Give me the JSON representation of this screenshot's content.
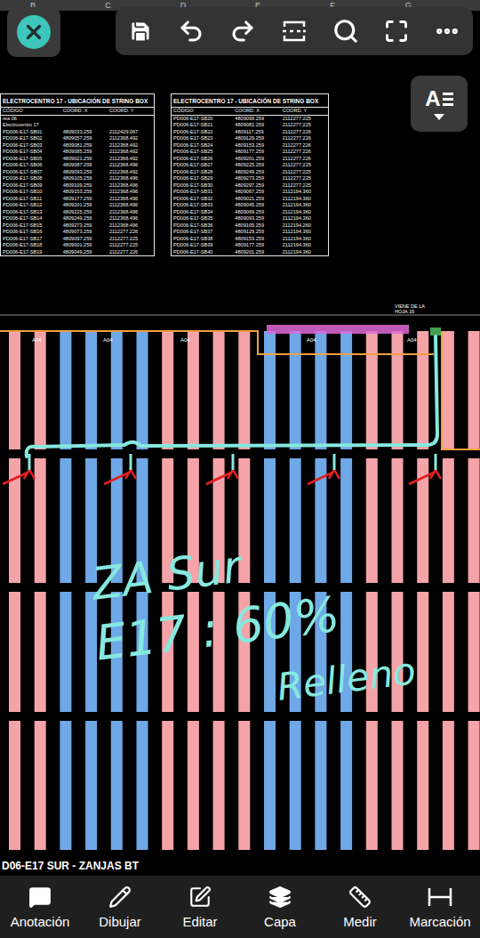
{
  "column_letters": [
    "B",
    "C",
    "D",
    "E",
    "F",
    "G"
  ],
  "format_button": {
    "label": "A"
  },
  "tables": [
    {
      "title": "ELECTROCENTRO 17 - UBICACIÓN DE STRING BOX",
      "columns": [
        "CÓDIGO",
        "COORD. X",
        "COORD. Y"
      ],
      "rows": [
        [
          "rea 06",
          "",
          ""
        ],
        [
          "Electrocentro 17",
          "",
          ""
        ],
        [
          "PD006-E17-SB01",
          "4809033.259",
          "2112429.067"
        ],
        [
          "PD006-E17-SB02",
          "4809057.259",
          "2112368.492"
        ],
        [
          "PD006-E17-SB03",
          "4809081.259",
          "2112368.492"
        ],
        [
          "PD006-E17-SB04",
          "4809085.259",
          "2112368.492"
        ],
        [
          "PD006-E17-SB05",
          "4809021.259",
          "2112368.492"
        ],
        [
          "PD006-E17-SB06",
          "4809087.259",
          "2112368.496"
        ],
        [
          "PD006-E17-SB07",
          "4809093.259",
          "2112368.492"
        ],
        [
          "PD006-E17-SB08",
          "4809105.259",
          "2112368.496"
        ],
        [
          "PD006-E17-SB09",
          "4809109.259",
          "2112368.496"
        ],
        [
          "PD006-E17-SB10",
          "4809153.259",
          "2112368.496"
        ],
        [
          "PD006-E17-SB11",
          "4809177.259",
          "2112368.496"
        ],
        [
          "PD006-E17-SB12",
          "4809201.259",
          "2112368.496"
        ],
        [
          "PD006-E17-SB13",
          "4809225.259",
          "2112368.496"
        ],
        [
          "PD006-E17-SB14",
          "4809249.259",
          "2112368.496"
        ],
        [
          "PD006-E17-SB15",
          "4809273.259",
          "2112368.496"
        ],
        [
          "PD006-E17-SB16",
          "4809073.259",
          "2112277.226"
        ],
        [
          "PD006-E17-SB17",
          "4809097.259",
          "2112277.225"
        ],
        [
          "PD006-E17-SB18",
          "4809001.259",
          "2112277.225"
        ],
        [
          "PD006-E17-SB19",
          "4809049.259",
          "2112277.226"
        ]
      ]
    },
    {
      "title": "ELECTROCENTRO 17 - UBICACIÓN DE STRING BOX",
      "columns": [
        "CÓDIGO",
        "COORD. X",
        "COORD. Y"
      ],
      "rows": [
        [
          "PD006-E17-SB20",
          "4809099.259",
          "2112277.225"
        ],
        [
          "PD006-E17-SB21",
          "4809081.259",
          "2112277.225"
        ],
        [
          "PD006-E17-SB22",
          "4809117.259",
          "2112277.226"
        ],
        [
          "PD006-E17-SB23",
          "4809129.259",
          "2112277.226"
        ],
        [
          "PD006-E17-SB24",
          "4809153.259",
          "2112277.226"
        ],
        [
          "PD006-E17-SB25",
          "4809177.259",
          "2112277.226"
        ],
        [
          "PD006-E17-SB26",
          "4809201.259",
          "2112277.226"
        ],
        [
          "PD006-E17-SB27",
          "4809225.259",
          "2112277.225"
        ],
        [
          "PD006-E17-SB28",
          "4809249.259",
          "2112277.225"
        ],
        [
          "PD006-E17-SB29",
          "4809273.259",
          "2112277.225"
        ],
        [
          "PD006-E17-SB30",
          "4809297.259",
          "2112277.225"
        ],
        [
          "PD006-E17-SB31",
          "4809067.259",
          "2112194.360"
        ],
        [
          "PD006-E17-SB32",
          "4809021.259",
          "2112194.360"
        ],
        [
          "PD006-E17-SB33",
          "4809045.259",
          "2112194.360"
        ],
        [
          "PD006-E17-SB34",
          "4809069.259",
          "2112194.360"
        ],
        [
          "PD006-E17-SB35",
          "4809093.259",
          "2112194.360"
        ],
        [
          "PD006-E17-SB36",
          "4809105.259",
          "2112194.260"
        ],
        [
          "PD006-E17-SB37",
          "4809129.259",
          "2112194.360"
        ],
        [
          "PD006-E17-SB38",
          "4809153.259",
          "2112194.360"
        ],
        [
          "PD006-E17-SB39",
          "4809177.259",
          "2112194.360"
        ],
        [
          "PD006-E17-SB40",
          "4809201.259",
          "2112194.360"
        ]
      ]
    }
  ],
  "drawing": {
    "sheet_ref": [
      "VIENE DE LA",
      "HOJA 16"
    ],
    "section_labels": [
      "A04",
      "A04",
      "A04",
      "A04",
      "A04"
    ],
    "strips": [
      {
        "color": "#f4a3a8"
      },
      {
        "color": "#f4a3a8"
      },
      {
        "color": "#6fa8e6"
      },
      {
        "color": "#6fa8e6"
      },
      {
        "color": "#6fa8e6"
      },
      {
        "color": "#6fa8e6"
      },
      {
        "color": "#f4a3a8"
      },
      {
        "color": "#f4a3a8"
      },
      {
        "color": "#f4a3a8"
      },
      {
        "color": "#f4a3a8"
      },
      {
        "color": "#6fa8e6"
      },
      {
        "color": "#6fa8e6"
      },
      {
        "color": "#6fa8e6"
      },
      {
        "color": "#6fa8e6"
      },
      {
        "color": "#f4a3a8"
      },
      {
        "color": "#f4a3a8"
      },
      {
        "color": "#f4a3a8"
      },
      {
        "color": "#f4a3a8"
      },
      {
        "color": "#f4a3a8"
      }
    ]
  },
  "annotation": {
    "lines": [
      "ZA Sur",
      "E17 : 60%",
      "Relleno"
    ]
  },
  "sheet_title": "D06-E17 SUR - ZANJAS BT",
  "bottom_nav": [
    {
      "label": "Anotación"
    },
    {
      "label": "Dibujar"
    },
    {
      "label": "Editar"
    },
    {
      "label": "Capa"
    },
    {
      "label": "Medir"
    },
    {
      "label": "Marcación"
    }
  ]
}
